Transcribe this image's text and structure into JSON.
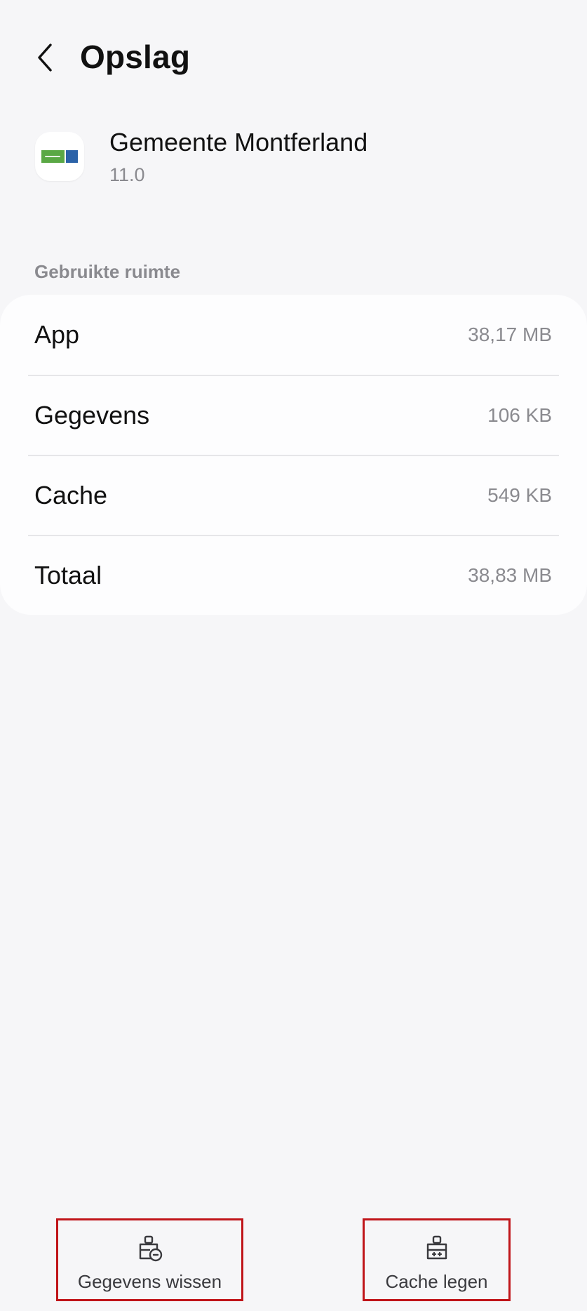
{
  "header": {
    "title": "Opslag",
    "back_icon": "chevron-left-icon"
  },
  "app": {
    "name": "Gemeente Montferland",
    "version": "11.0",
    "icon": "app-logo",
    "brand_colors": {
      "green": "#5aa845",
      "blue": "#2b62a8"
    }
  },
  "storage": {
    "section_label": "Gebruikte ruimte",
    "rows": [
      {
        "label": "App",
        "value": "38,17 MB"
      },
      {
        "label": "Gegevens",
        "value": "106 KB"
      },
      {
        "label": "Cache",
        "value": "549 KB"
      },
      {
        "label": "Totaal",
        "value": "38,83 MB"
      }
    ]
  },
  "actions": {
    "clear_data": {
      "label": "Gegevens wissen",
      "icon": "clear-data-icon"
    },
    "clear_cache": {
      "label": "Cache legen",
      "icon": "clear-cache-brush-icon"
    }
  },
  "colors": {
    "background": "#f6f6f8",
    "card": "#fdfdfe",
    "secondary_text": "#8a8a8f",
    "highlight_border": "#c0151a"
  }
}
